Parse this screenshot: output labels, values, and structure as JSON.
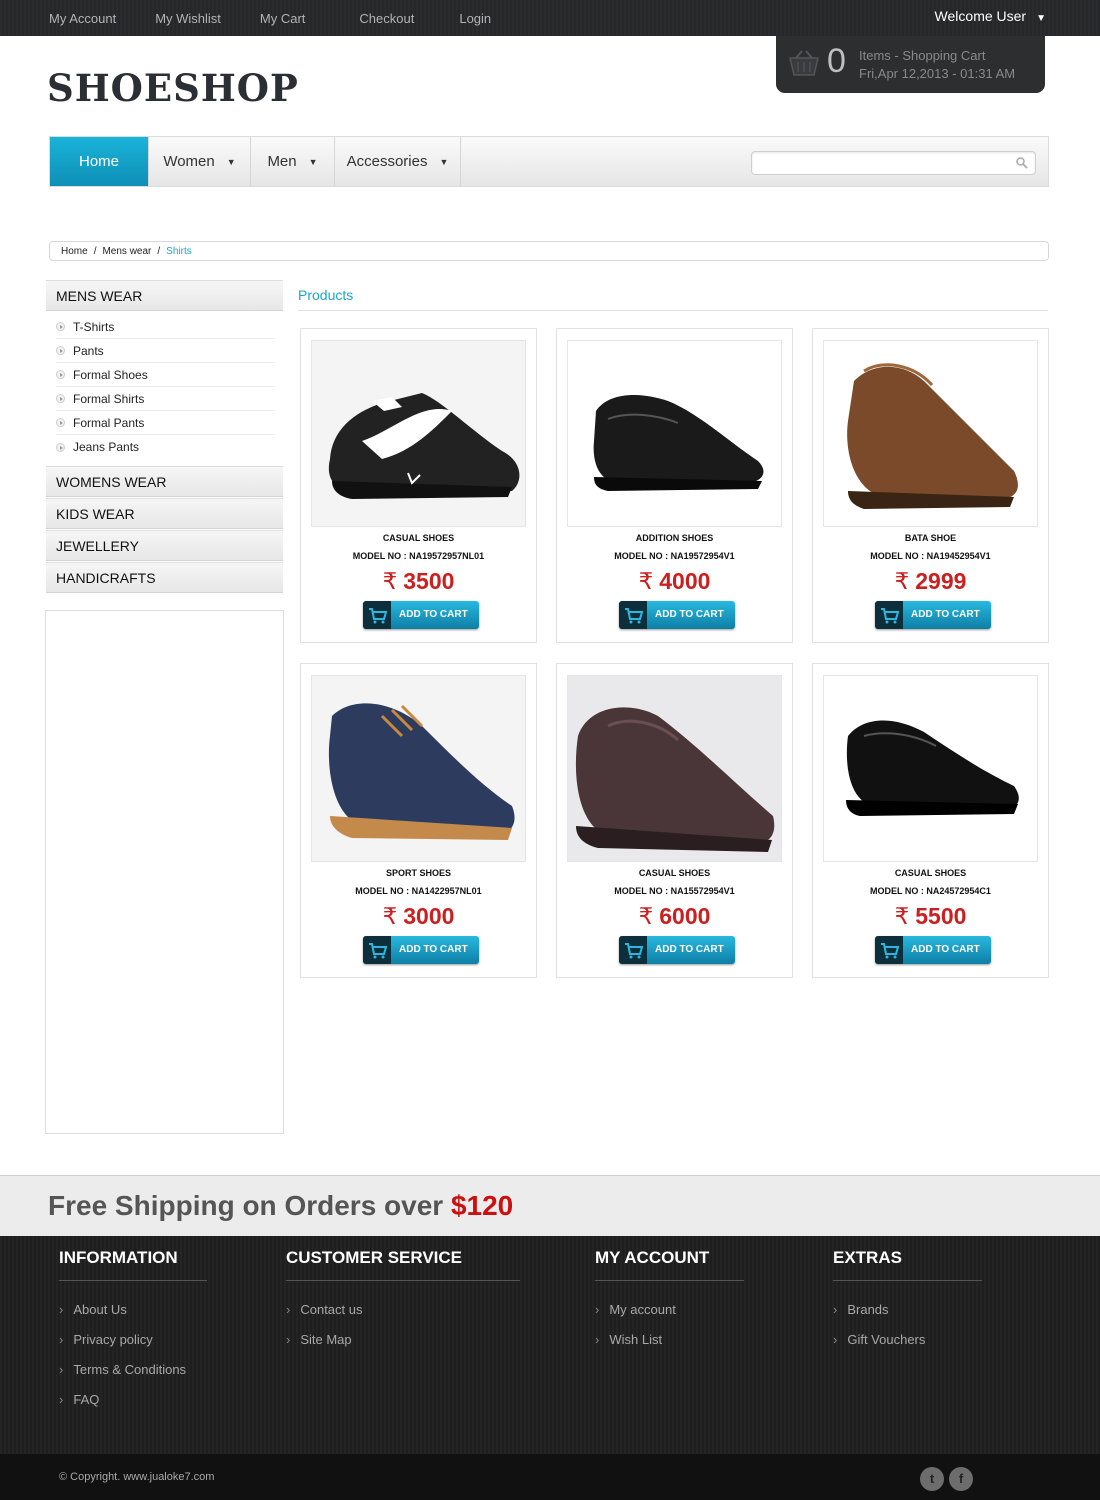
{
  "topbar": {
    "links": [
      "My Account",
      "My Wishlist",
      "My Cart",
      "Checkout",
      "Login"
    ],
    "welcome": "Welcome User"
  },
  "cart": {
    "count": "0",
    "label": "Items - Shopping Cart",
    "datetime": "Fri,Apr 12,2013 - 01:31 AM"
  },
  "logo": "SHOESHOP",
  "nav": {
    "home": "Home",
    "women": "Women",
    "men": "Men",
    "accessories": "Accessories",
    "search_placeholder": ""
  },
  "breadcrumb": {
    "items": [
      "Home",
      "Mens wear",
      "Shirts"
    ]
  },
  "sidebar": {
    "mens_wear": {
      "title": "MENS WEAR",
      "items": [
        "T-Shirts",
        "Pants",
        "Formal Shoes",
        "Formal Shirts",
        "Formal Pants",
        "Jeans Pants"
      ]
    },
    "sections": [
      "WOMENS WEAR",
      "KIDS WEAR",
      "JEWELLERY",
      "HANDICRAFTS"
    ]
  },
  "products": {
    "title": "Products",
    "add_label": "ADD TO CART",
    "currency": "₹",
    "items": [
      {
        "name": "CASUAL SHOES",
        "model": "MODEL NO : NA19572957NL01",
        "price": "3500"
      },
      {
        "name": "ADDITION SHOES",
        "model": "MODEL NO : NA19572954V1",
        "price": "4000"
      },
      {
        "name": "BATA SHOE",
        "model": "MODEL NO : NA19452954V1",
        "price": "2999"
      },
      {
        "name": "SPORT SHOES",
        "model": "MODEL NO : NA1422957NL01",
        "price": "3000"
      },
      {
        "name": "CASUAL SHOES",
        "model": "MODEL NO : NA15572954V1",
        "price": "6000"
      },
      {
        "name": "CASUAL SHOES",
        "model": "MODEL NO : NA24572954C1",
        "price": "5500"
      }
    ]
  },
  "shipping": {
    "text": "Free Shipping on Orders over",
    "amount": "$120"
  },
  "footer": {
    "information": {
      "title": "INFORMATION",
      "items": [
        "About Us",
        "Privacy policy",
        "Terms & Conditions",
        "FAQ"
      ]
    },
    "customer_service": {
      "title": "CUSTOMER SERVICE",
      "items": [
        "Contact us",
        "Site Map"
      ]
    },
    "my_account": {
      "title": "MY ACCOUNT",
      "items": [
        "My account",
        "Wish List"
      ]
    },
    "extras": {
      "title": "EXTRAS",
      "items": [
        "Brands",
        "Gift Vouchers"
      ]
    },
    "copyright": "© Copyright. www.jualoke7.com"
  },
  "colors": {
    "accent": "#19a7cf",
    "price": "#cc1f1f",
    "ship_amount": "#cc1010"
  },
  "icons": [
    "basket-icon",
    "search-icon",
    "cart-icon",
    "twitter-icon",
    "facebook-icon"
  ]
}
